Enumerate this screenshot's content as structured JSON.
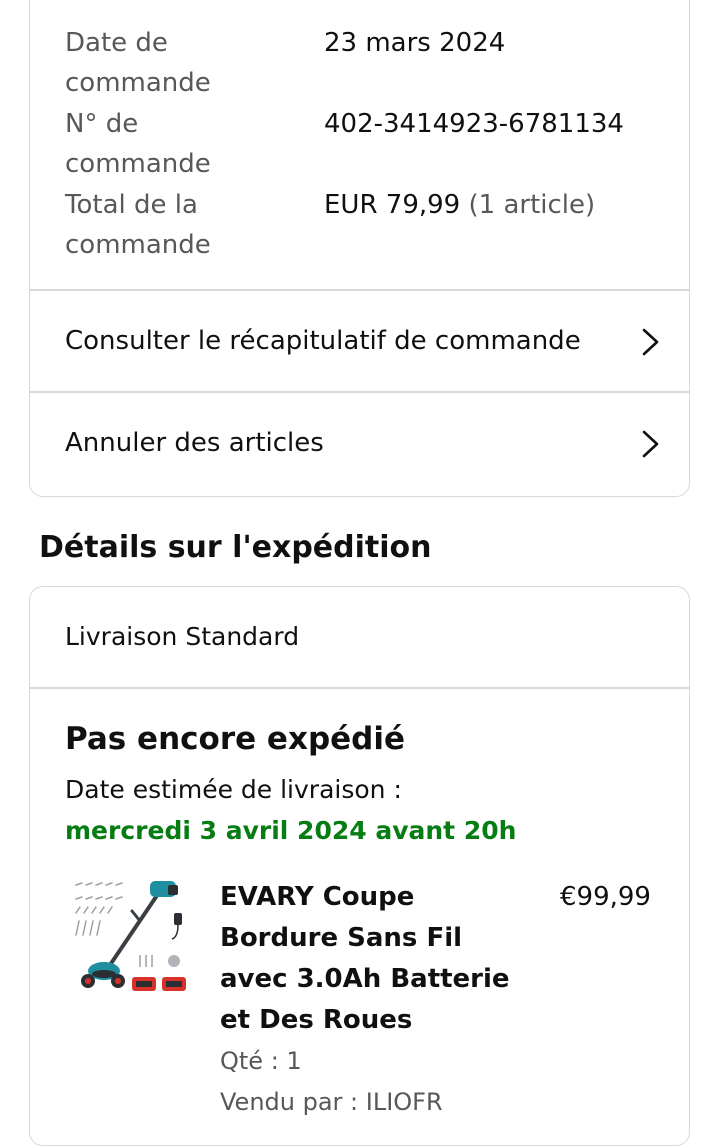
{
  "order": {
    "date_label": "Date de commande",
    "date_value": "23 mars 2024",
    "number_label": "N° de commande",
    "number_value": "402-3414923-6781134",
    "total_label": "Total de la commande",
    "total_value": "EUR 79,99",
    "total_items": "(1 article)"
  },
  "links": {
    "summary": "Consulter le récapitulatif de commande",
    "cancel": "Annuler des articles"
  },
  "shipping": {
    "section_title": "Détails sur l'expédition",
    "delivery_type": "Livraison Standard",
    "status": "Pas encore expédié",
    "estimate_label": "Date estimée de livraison :",
    "estimate_date": "mercredi 3 avril 2024 avant 20h"
  },
  "product": {
    "title": "EVARY Coupe Bordure Sans Fil avec 3.0Ah Batterie et Des Roues",
    "price": "€99,99",
    "quantity": "Qté : 1",
    "seller": "Vendu par : ILIOFR",
    "image": "string-trimmer-product-photo"
  },
  "colors": {
    "delivery_green": "#067d12",
    "muted_text": "#565959",
    "border": "#d5d9d9",
    "tool_teal": "#1f8fa0",
    "battery_red": "#d8312a"
  },
  "icons": {
    "chevron": "chevron-right-icon"
  }
}
